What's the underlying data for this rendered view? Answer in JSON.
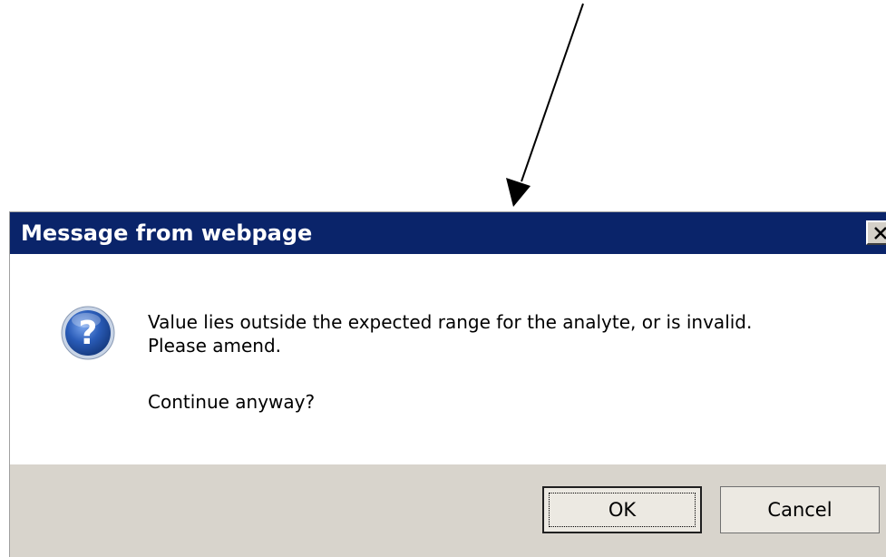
{
  "dialog": {
    "title": "Message from webpage",
    "close_glyph": "✕",
    "icon": "question-icon",
    "message_lines": [
      "Value lies outside the expected range for the analyte, or is invalid.",
      "Please amend.",
      "Continue anyway?"
    ],
    "buttons": {
      "ok": "OK",
      "cancel": "Cancel"
    }
  },
  "colors": {
    "titlebar": "#0a246a",
    "button_bar": "#d8d4cc",
    "icon_blue": "#2a5cb8"
  }
}
